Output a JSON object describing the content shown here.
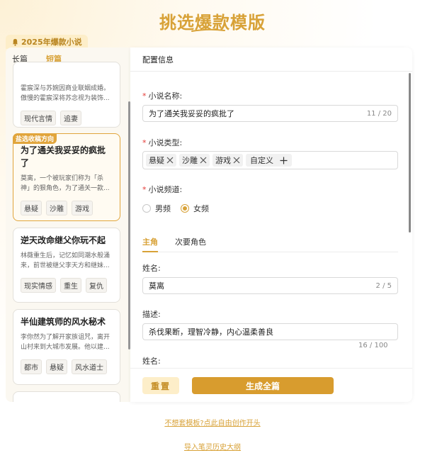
{
  "page_title": "挑选爆款模版",
  "badge_label": "2025年爆款小说",
  "left_tabs": [
    {
      "label": "长篇",
      "active": false
    },
    {
      "label": "短篇",
      "active": true
    }
  ],
  "cards": [
    {
      "title": "",
      "desc": "霍宸深与苏婉因商业联姻成婚。傲慢的霍宸深将苏念视为装饰...",
      "tags": [
        "现代言情",
        "追妻"
      ]
    },
    {
      "ribbon": "盐选收稿方向",
      "title": "为了通关我妥妥的疯批了",
      "desc": "莫离，一个被玩家们称为「杀神」的狠角色，为了通关一款...",
      "tags": [
        "悬疑",
        "沙雕",
        "游戏"
      ]
    },
    {
      "title": "逆天改命继父你玩不起",
      "desc": "林薇重生后，记忆如同潮水般涌来，前世被继父李天方和继妹...",
      "tags": [
        "现实情感",
        "重生",
        "复仇"
      ]
    },
    {
      "title": "半仙建筑师的风水秘术",
      "desc": "李你然为了解开家族诅咒，离开山村来到大城市发展。他以建...",
      "tags": [
        "都市",
        "悬疑",
        "风水道士"
      ]
    }
  ],
  "panel_header": "配置信息",
  "form": {
    "name_label": "小说名称:",
    "name_value": "为了通关我妥妥的疯批了",
    "name_counter": "11 / 20",
    "type_label": "小说类型:",
    "type_chips": [
      "悬疑",
      "沙雕",
      "游戏"
    ],
    "custom_chip": "自定义",
    "channel_label": "小说频道:",
    "channel_options": [
      {
        "label": "男频",
        "checked": false
      },
      {
        "label": "女频",
        "checked": true
      }
    ],
    "role_tabs": [
      {
        "label": "主角",
        "active": true
      },
      {
        "label": "次要角色",
        "active": false
      }
    ],
    "role_name_label": "姓名:",
    "role_name_value": "莫离",
    "role_name_counter": "2 / 5",
    "desc_label": "描述:",
    "desc_value": "杀伐果断，理智冷静，内心温柔善良",
    "desc_counter": "16 / 100",
    "role_name_label_2": "姓名:"
  },
  "buttons": {
    "reset": "重置",
    "generate": "生成全篇"
  },
  "links": {
    "free_create": "不想套模板?点此自由创作开头",
    "import_outline": "导入笔灵历史大纲"
  },
  "colors": {
    "accent": "#d8a238",
    "required": "#e53935"
  }
}
